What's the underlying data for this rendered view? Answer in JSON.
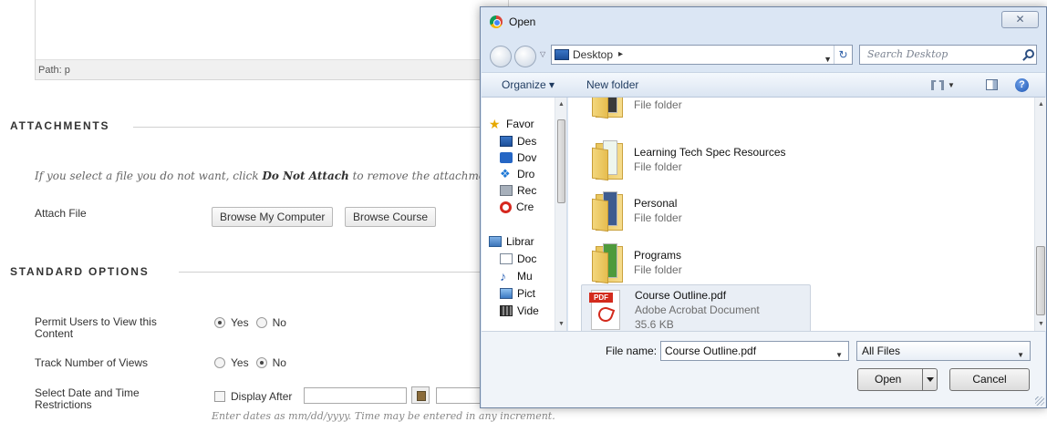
{
  "page": {
    "editor_path": "Path: p",
    "attachments": {
      "title": "ATTACHMENTS",
      "hint_prefix": "If you select a file you do not want, click ",
      "hint_bold": "Do Not Attach",
      "hint_suffix": " to remove the attachme",
      "attach_file_label": "Attach File",
      "browse_computer_label": "Browse My Computer",
      "browse_course_label": "Browse Course"
    },
    "standard_options": {
      "title": "STANDARD OPTIONS",
      "permit_label": "Permit Users to View this Content",
      "permit_yes": "Yes",
      "permit_no": "No",
      "permit_selected": "Yes",
      "track_label": "Track Number of Views",
      "track_yes": "Yes",
      "track_no": "No",
      "track_selected": "No",
      "date_label": "Select Date and Time Restrictions",
      "display_after_label": "Display After",
      "date_hint": "Enter dates as mm/dd/yyyy. Time may be entered in any increment."
    }
  },
  "dialog": {
    "title": "Open",
    "close_glyph": "✕",
    "address": "Desktop",
    "address_arrow": "▸",
    "search_placeholder": "Search Desktop",
    "toolbar": {
      "organize_label": "Organize ▾",
      "new_folder_label": "New folder",
      "help_glyph": "?"
    },
    "nav_items": [
      {
        "label": "Favor",
        "icon": "star-icon"
      },
      {
        "label": "Des",
        "icon": "desktop-icon"
      },
      {
        "label": "Dov",
        "icon": "downloads-icon"
      },
      {
        "label": "Dro",
        "icon": "dropbox-icon"
      },
      {
        "label": "Rec",
        "icon": "recent-places-icon"
      },
      {
        "label": "Cre",
        "icon": "creative-cloud-icon"
      },
      {
        "label": "Librar",
        "icon": "libraries-icon"
      },
      {
        "label": "Doc",
        "icon": "documents-icon"
      },
      {
        "label": "Mu",
        "icon": "music-icon"
      },
      {
        "label": "Pict",
        "icon": "pictures-icon"
      },
      {
        "label": "Vide",
        "icon": "videos-icon"
      }
    ],
    "files": [
      {
        "name": "",
        "type": "File folder",
        "size": ""
      },
      {
        "name": "Learning Tech Spec Resources",
        "type": "File folder",
        "size": ""
      },
      {
        "name": "Personal",
        "type": "File folder",
        "size": ""
      },
      {
        "name": "Programs",
        "type": "File folder",
        "size": ""
      },
      {
        "name": "Course Outline.pdf",
        "type": "Adobe Acrobat Document",
        "size": "35.6 KB",
        "badge": "PDF"
      }
    ],
    "file_name_label": "File name:",
    "file_name_value": "Course Outline.pdf",
    "filter_value": "All Files",
    "open_label": "Open",
    "cancel_label": "Cancel"
  }
}
